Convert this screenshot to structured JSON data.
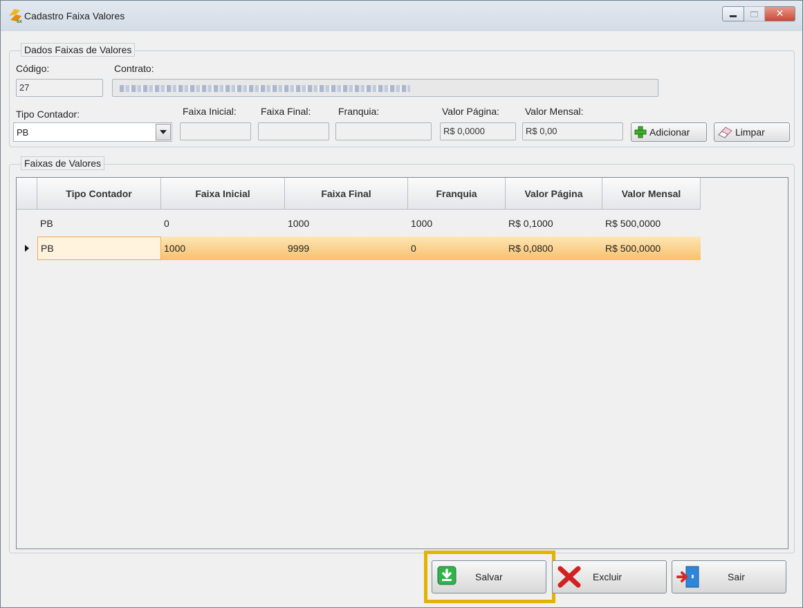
{
  "window": {
    "title": "Cadastro Faixa Valores"
  },
  "dados_group": {
    "legend": "Dados Faixas de Valores",
    "codigo_label": "Código:",
    "codigo_value": "27",
    "contrato_label": "Contrato:",
    "tipo_contador_label": "Tipo Contador:",
    "tipo_contador_value": "PB",
    "faixa_inicial_label": "Faixa Inicial:",
    "faixa_final_label": "Faixa Final:",
    "franquia_label": "Franquia:",
    "valor_pagina_label": "Valor Página:",
    "valor_pagina_value": "R$ 0,0000",
    "valor_mensal_label": "Valor Mensal:",
    "valor_mensal_value": "R$ 0,00",
    "adicionar_label": "Adicionar",
    "limpar_label": "Limpar"
  },
  "faixas_group": {
    "legend": "Faixas de Valores",
    "columns": [
      "Tipo Contador",
      "Faixa Inicial",
      "Faixa Final",
      "Franquia",
      "Valor Página",
      "Valor Mensal"
    ],
    "rows": [
      [
        "PB",
        "0",
        "1000",
        "1000",
        "R$ 0,1000",
        "R$ 500,0000"
      ],
      [
        "PB",
        "1000",
        "9999",
        "0",
        "R$ 0,0800",
        "R$ 500,0000"
      ]
    ],
    "selected_row": 1
  },
  "footer": {
    "salvar_label": "Salvar",
    "excluir_label": "Excluir",
    "sair_label": "Sair"
  },
  "colors": {
    "highlight": "#e2b300",
    "selected_row": "#f8c06e"
  }
}
